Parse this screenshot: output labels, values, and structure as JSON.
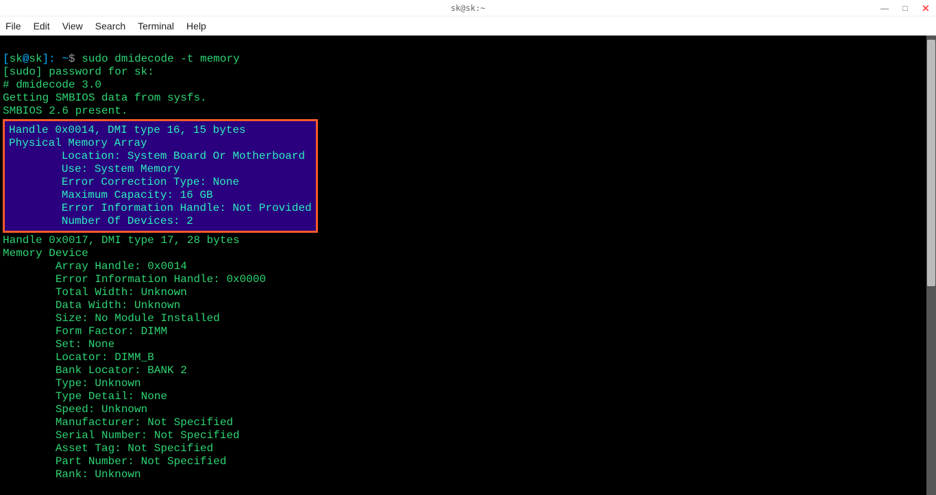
{
  "window": {
    "title": "sk@sk:~",
    "controls": {
      "min": "—",
      "max": "□",
      "close": "✕"
    }
  },
  "menubar": [
    "File",
    "Edit",
    "View",
    "Search",
    "Terminal",
    "Help"
  ],
  "prompt": {
    "open": "[",
    "user": "sk",
    "at": "@",
    "host": "sk",
    "close": "]",
    "colon": ":",
    "path": " ~",
    "dollar": "$",
    "command": " sudo dmidecode -t memory"
  },
  "preamble": [
    "[sudo] password for sk:",
    "# dmidecode 3.0",
    "Getting SMBIOS data from sysfs.",
    "SMBIOS 2.6 present."
  ],
  "highlight": {
    "header": "Handle 0x0014, DMI type 16, 15 bytes",
    "title": "Physical Memory Array",
    "lines": [
      "        Location: System Board Or Motherboard",
      "        Use: System Memory",
      "        Error Correction Type: None",
      "        Maximum Capacity: 16 GB",
      "        Error Information Handle: Not Provided",
      "        Number Of Devices: 2"
    ]
  },
  "block2": {
    "header": "Handle 0x0017, DMI type 17, 28 bytes",
    "title": "Memory Device",
    "lines": [
      "        Array Handle: 0x0014",
      "        Error Information Handle: 0x0000",
      "        Total Width: Unknown",
      "        Data Width: Unknown",
      "        Size: No Module Installed",
      "        Form Factor: DIMM",
      "        Set: None",
      "        Locator: DIMM_B",
      "        Bank Locator: BANK 2",
      "        Type: Unknown",
      "        Type Detail: None",
      "        Speed: Unknown",
      "        Manufacturer: Not Specified",
      "        Serial Number: Not Specified",
      "        Asset Tag: Not Specified",
      "        Part Number: Not Specified",
      "        Rank: Unknown"
    ]
  }
}
